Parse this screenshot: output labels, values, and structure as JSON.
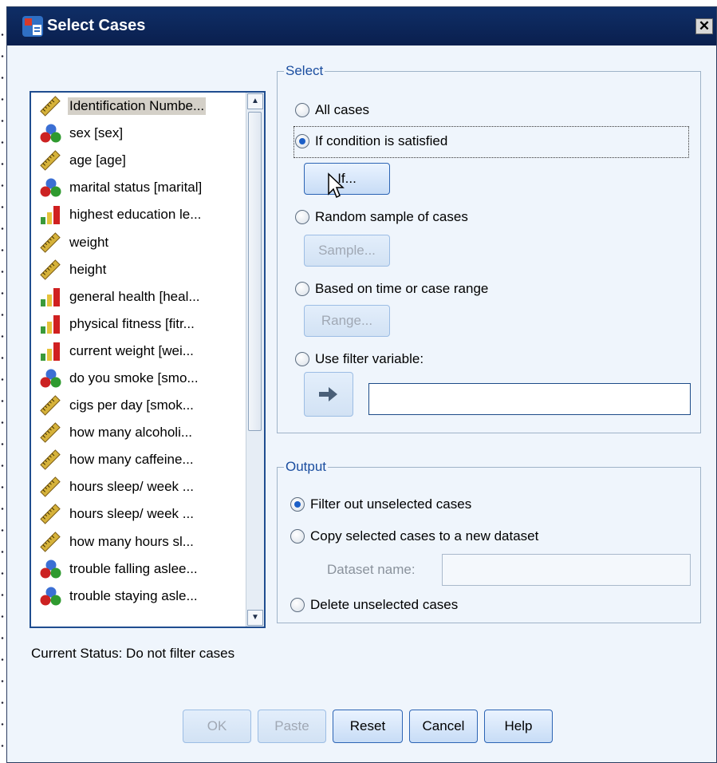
{
  "window": {
    "title": "Select Cases",
    "close_label": "✕"
  },
  "variables": [
    {
      "label": "Identification Numbe...",
      "type": "scale"
    },
    {
      "label": "sex [sex]",
      "type": "nominal"
    },
    {
      "label": "age [age]",
      "type": "scale"
    },
    {
      "label": "marital status [marital]",
      "type": "nominal"
    },
    {
      "label": "highest education le...",
      "type": "ordinal"
    },
    {
      "label": "weight",
      "type": "scale"
    },
    {
      "label": "height",
      "type": "scale"
    },
    {
      "label": "general health [heal...",
      "type": "ordinal"
    },
    {
      "label": "physical fitness [fitr...",
      "type": "ordinal"
    },
    {
      "label": "current weight [wei...",
      "type": "ordinal"
    },
    {
      "label": "do you smoke [smo...",
      "type": "nominal"
    },
    {
      "label": "cigs per day  [smok...",
      "type": "scale"
    },
    {
      "label": "how  many alcoholi...",
      "type": "scale"
    },
    {
      "label": "how many caffeine...",
      "type": "scale"
    },
    {
      "label": "hours sleep/ week ...",
      "type": "scale"
    },
    {
      "label": "hours sleep/ week ...",
      "type": "scale"
    },
    {
      "label": "how many hours sl...",
      "type": "scale"
    },
    {
      "label": "trouble falling aslee...",
      "type": "nominal"
    },
    {
      "label": "trouble staying asle...",
      "type": "nominal"
    }
  ],
  "select": {
    "title": "Select",
    "all_cases": "All cases",
    "if_condition": "If condition is satisfied",
    "if_button": "If...",
    "random_sample": "Random sample of cases",
    "sample_button": "Sample...",
    "time_range": "Based on time or case range",
    "range_button": "Range...",
    "filter_variable": "Use filter variable:",
    "filter_value": ""
  },
  "output": {
    "title": "Output",
    "filter_out": "Filter out unselected cases",
    "copy_to_dataset": "Copy selected cases to a new dataset",
    "dataset_name_label": "Dataset name:",
    "dataset_name_value": "",
    "delete_unselected": "Delete unselected cases"
  },
  "status": "Current Status: Do not filter cases",
  "buttons": {
    "ok": "OK",
    "paste": "Paste",
    "reset": "Reset",
    "cancel": "Cancel",
    "help": "Help"
  },
  "icon_colors": {
    "scale": "#d6b23a",
    "nominal_red": "#cc2222",
    "nominal_green": "#2f9a2f",
    "nominal_blue": "#3b6fd4",
    "ordinal": "#d02020"
  }
}
